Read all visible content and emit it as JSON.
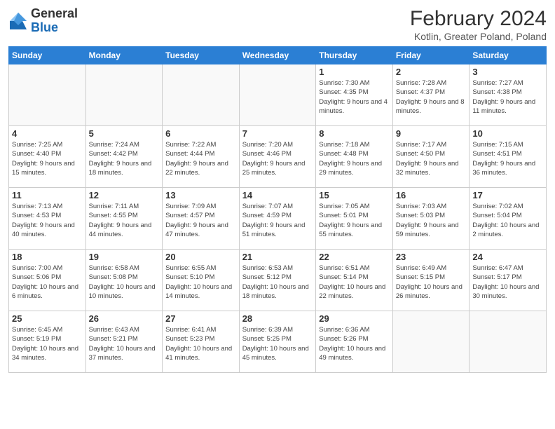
{
  "logo": {
    "general": "General",
    "blue": "Blue"
  },
  "title": "February 2024",
  "subtitle": "Kotlin, Greater Poland, Poland",
  "headers": [
    "Sunday",
    "Monday",
    "Tuesday",
    "Wednesday",
    "Thursday",
    "Friday",
    "Saturday"
  ],
  "weeks": [
    [
      {
        "day": "",
        "info": ""
      },
      {
        "day": "",
        "info": ""
      },
      {
        "day": "",
        "info": ""
      },
      {
        "day": "",
        "info": ""
      },
      {
        "day": "1",
        "info": "Sunrise: 7:30 AM\nSunset: 4:35 PM\nDaylight: 9 hours\nand 4 minutes."
      },
      {
        "day": "2",
        "info": "Sunrise: 7:28 AM\nSunset: 4:37 PM\nDaylight: 9 hours\nand 8 minutes."
      },
      {
        "day": "3",
        "info": "Sunrise: 7:27 AM\nSunset: 4:38 PM\nDaylight: 9 hours\nand 11 minutes."
      }
    ],
    [
      {
        "day": "4",
        "info": "Sunrise: 7:25 AM\nSunset: 4:40 PM\nDaylight: 9 hours\nand 15 minutes."
      },
      {
        "day": "5",
        "info": "Sunrise: 7:24 AM\nSunset: 4:42 PM\nDaylight: 9 hours\nand 18 minutes."
      },
      {
        "day": "6",
        "info": "Sunrise: 7:22 AM\nSunset: 4:44 PM\nDaylight: 9 hours\nand 22 minutes."
      },
      {
        "day": "7",
        "info": "Sunrise: 7:20 AM\nSunset: 4:46 PM\nDaylight: 9 hours\nand 25 minutes."
      },
      {
        "day": "8",
        "info": "Sunrise: 7:18 AM\nSunset: 4:48 PM\nDaylight: 9 hours\nand 29 minutes."
      },
      {
        "day": "9",
        "info": "Sunrise: 7:17 AM\nSunset: 4:50 PM\nDaylight: 9 hours\nand 32 minutes."
      },
      {
        "day": "10",
        "info": "Sunrise: 7:15 AM\nSunset: 4:51 PM\nDaylight: 9 hours\nand 36 minutes."
      }
    ],
    [
      {
        "day": "11",
        "info": "Sunrise: 7:13 AM\nSunset: 4:53 PM\nDaylight: 9 hours\nand 40 minutes."
      },
      {
        "day": "12",
        "info": "Sunrise: 7:11 AM\nSunset: 4:55 PM\nDaylight: 9 hours\nand 44 minutes."
      },
      {
        "day": "13",
        "info": "Sunrise: 7:09 AM\nSunset: 4:57 PM\nDaylight: 9 hours\nand 47 minutes."
      },
      {
        "day": "14",
        "info": "Sunrise: 7:07 AM\nSunset: 4:59 PM\nDaylight: 9 hours\nand 51 minutes."
      },
      {
        "day": "15",
        "info": "Sunrise: 7:05 AM\nSunset: 5:01 PM\nDaylight: 9 hours\nand 55 minutes."
      },
      {
        "day": "16",
        "info": "Sunrise: 7:03 AM\nSunset: 5:03 PM\nDaylight: 9 hours\nand 59 minutes."
      },
      {
        "day": "17",
        "info": "Sunrise: 7:02 AM\nSunset: 5:04 PM\nDaylight: 10 hours\nand 2 minutes."
      }
    ],
    [
      {
        "day": "18",
        "info": "Sunrise: 7:00 AM\nSunset: 5:06 PM\nDaylight: 10 hours\nand 6 minutes."
      },
      {
        "day": "19",
        "info": "Sunrise: 6:58 AM\nSunset: 5:08 PM\nDaylight: 10 hours\nand 10 minutes."
      },
      {
        "day": "20",
        "info": "Sunrise: 6:55 AM\nSunset: 5:10 PM\nDaylight: 10 hours\nand 14 minutes."
      },
      {
        "day": "21",
        "info": "Sunrise: 6:53 AM\nSunset: 5:12 PM\nDaylight: 10 hours\nand 18 minutes."
      },
      {
        "day": "22",
        "info": "Sunrise: 6:51 AM\nSunset: 5:14 PM\nDaylight: 10 hours\nand 22 minutes."
      },
      {
        "day": "23",
        "info": "Sunrise: 6:49 AM\nSunset: 5:15 PM\nDaylight: 10 hours\nand 26 minutes."
      },
      {
        "day": "24",
        "info": "Sunrise: 6:47 AM\nSunset: 5:17 PM\nDaylight: 10 hours\nand 30 minutes."
      }
    ],
    [
      {
        "day": "25",
        "info": "Sunrise: 6:45 AM\nSunset: 5:19 PM\nDaylight: 10 hours\nand 34 minutes."
      },
      {
        "day": "26",
        "info": "Sunrise: 6:43 AM\nSunset: 5:21 PM\nDaylight: 10 hours\nand 37 minutes."
      },
      {
        "day": "27",
        "info": "Sunrise: 6:41 AM\nSunset: 5:23 PM\nDaylight: 10 hours\nand 41 minutes."
      },
      {
        "day": "28",
        "info": "Sunrise: 6:39 AM\nSunset: 5:25 PM\nDaylight: 10 hours\nand 45 minutes."
      },
      {
        "day": "29",
        "info": "Sunrise: 6:36 AM\nSunset: 5:26 PM\nDaylight: 10 hours\nand 49 minutes."
      },
      {
        "day": "",
        "info": ""
      },
      {
        "day": "",
        "info": ""
      }
    ]
  ]
}
